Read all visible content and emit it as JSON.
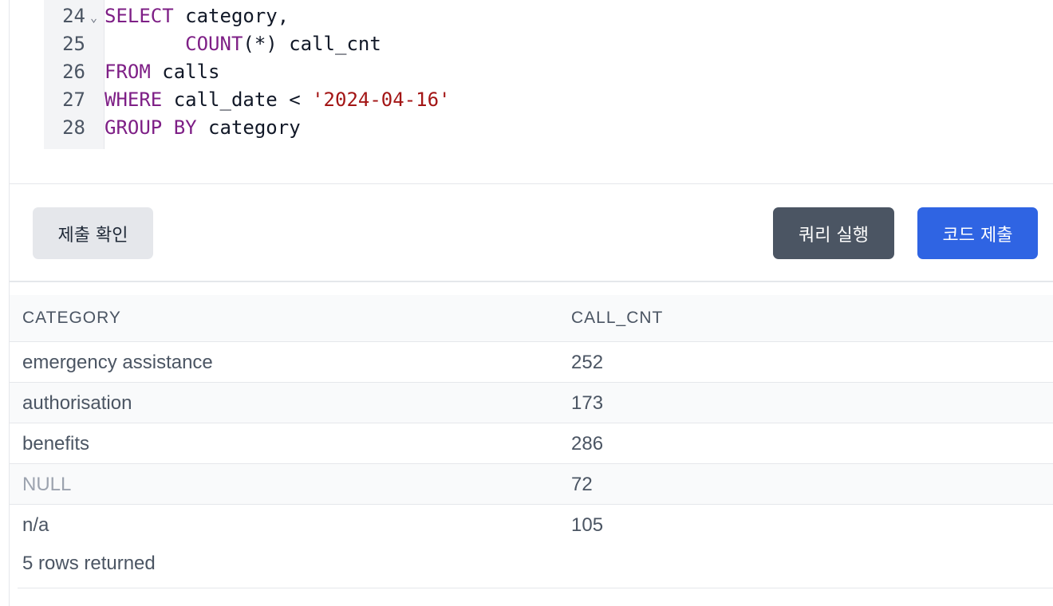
{
  "editor": {
    "lines": [
      {
        "num": "24",
        "fold": "⌄",
        "tokens": [
          {
            "t": "SELECT",
            "c": "kw"
          },
          {
            "t": " category,",
            "c": ""
          }
        ]
      },
      {
        "num": "25",
        "fold": "",
        "tokens": [
          {
            "t": "       ",
            "c": ""
          },
          {
            "t": "COUNT",
            "c": "kw"
          },
          {
            "t": "(*) call_cnt",
            "c": ""
          }
        ]
      },
      {
        "num": "26",
        "fold": "",
        "tokens": [
          {
            "t": "FROM",
            "c": "kw"
          },
          {
            "t": " calls",
            "c": ""
          }
        ]
      },
      {
        "num": "27",
        "fold": "",
        "tokens": [
          {
            "t": "WHERE",
            "c": "kw"
          },
          {
            "t": " call_date < ",
            "c": ""
          },
          {
            "t": "'2024-04-16'",
            "c": "str"
          }
        ]
      },
      {
        "num": "28",
        "fold": "",
        "tokens": [
          {
            "t": "GROUP BY",
            "c": "kw"
          },
          {
            "t": " category",
            "c": ""
          }
        ]
      }
    ]
  },
  "actions": {
    "check_label": "제출 확인",
    "run_label": "쿼리 실행",
    "submit_label": "코드 제출"
  },
  "results": {
    "columns": [
      "CATEGORY",
      "CALL_CNT"
    ],
    "rows": [
      {
        "category": "emergency assistance",
        "call_cnt": "252",
        "is_null": false
      },
      {
        "category": "authorisation",
        "call_cnt": "173",
        "is_null": false
      },
      {
        "category": "benefits",
        "call_cnt": "286",
        "is_null": false
      },
      {
        "category": "NULL",
        "call_cnt": "72",
        "is_null": true
      },
      {
        "category": "n/a",
        "call_cnt": "105",
        "is_null": false
      }
    ],
    "footer": "5 rows returned"
  },
  "colors": {
    "keyword": "#7e1f86",
    "string": "#a31515",
    "primary_button": "#2f64e3",
    "run_button": "#4b5563",
    "secondary_button": "#e5e7eb"
  }
}
